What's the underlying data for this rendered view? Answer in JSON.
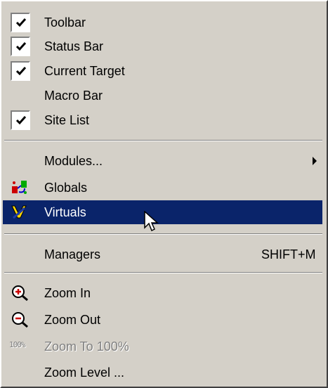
{
  "menu": {
    "items": [
      {
        "label": "Toolbar",
        "checked": true
      },
      {
        "label": "Status Bar",
        "checked": true
      },
      {
        "label": "Current Target",
        "checked": true
      },
      {
        "label": "Macro Bar",
        "checked": false
      },
      {
        "label": "Site List",
        "checked": true
      },
      {
        "label": "Modules...",
        "submenu": true
      },
      {
        "label": "Globals",
        "icon": "globals-icon"
      },
      {
        "label": "Virtuals",
        "icon": "virtuals-icon",
        "highlighted": true
      },
      {
        "label": "Managers",
        "shortcut": "SHIFT+M"
      },
      {
        "label": "Zoom In",
        "icon": "zoom-in-icon"
      },
      {
        "label": "Zoom Out",
        "icon": "zoom-out-icon"
      },
      {
        "label": "Zoom To 100%",
        "icon": "zoom-100-icon",
        "icon_text": "100%",
        "disabled": true
      },
      {
        "label": "Zoom Level ..."
      }
    ]
  },
  "colors": {
    "menu_bg": "#d4d0c8",
    "highlight_bg": "#0a246a",
    "highlight_text": "#ffffff",
    "disabled_text": "#808080"
  }
}
